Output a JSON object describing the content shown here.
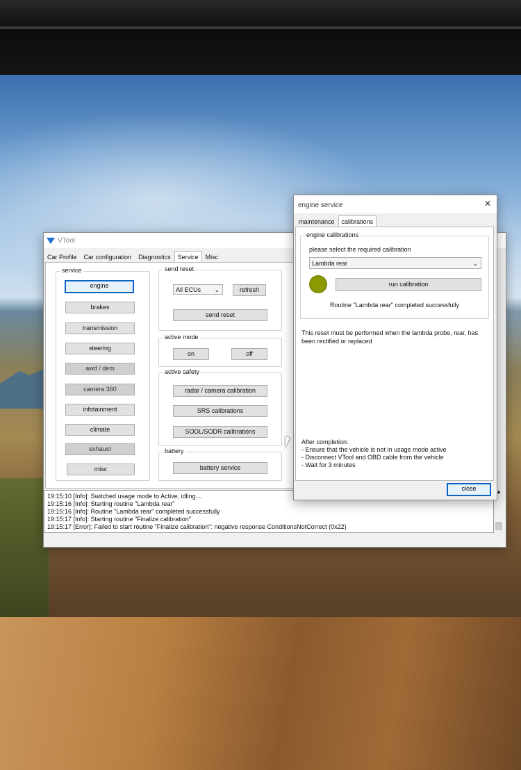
{
  "vtool": {
    "title": "VTool",
    "tabs": [
      "Car Profile",
      "Car configuration",
      "Diagnostics",
      "Service",
      "Misc"
    ],
    "active_tab": "Service",
    "service_group": {
      "label": "service",
      "buttons": [
        "engine",
        "brakes",
        "transmission",
        "steering",
        "awd / dem",
        "camera 360",
        "infotainment",
        "climate",
        "exhaust",
        "misc"
      ]
    },
    "send_reset": {
      "label": "send reset",
      "ecu_select": "All ECUs",
      "refresh": "refresh",
      "send": "send reset"
    },
    "active_mode": {
      "label": "active mode",
      "on": "on",
      "off": "off"
    },
    "active_safety": {
      "label": "active safety",
      "buttons": [
        "radar / camera calibration",
        "SRS calibrations",
        "SODL/SODR calibrations"
      ]
    },
    "battery": {
      "label": "battery",
      "button": "battery service"
    },
    "log": [
      "19:15:10 [Info]: Switched usage mode to Active, idling....",
      "19:15:16 [Info]: Starting routine \"Lambda rear\"",
      "19:15:16 [Info]: Routine \"Lambda rear\" completed successfully",
      "19:15:17 [Info]: Starting routine \"Finalize calibration\"",
      "19:15:17 [Error]: Failed to start routine \"Finalize calibration\": negative response ConditionsNotCorrect (0x22)"
    ]
  },
  "engine_service": {
    "title": "engine service",
    "close_glyph": "✕",
    "tabs": [
      "maintenance",
      "calibrations"
    ],
    "active_tab": "calibrations",
    "group_label": "engine calibrations",
    "prompt": "please select the required calibration",
    "selected": "Lambda rear",
    "run_button": "run calibration",
    "status_color": "#8a9a00",
    "result": "Routine \"Lambda rear\" completed successfully",
    "description": "This reset must be performed when the lambda probe, rear, has been rectified or replaced",
    "after_lines": [
      "After completion:",
      "- Ensure that the vehicle is not in usage mode active",
      "- Disconnect VTool and OBD cable from the vehicle",
      "- Wait for 3 minutes"
    ],
    "close_button": "close"
  },
  "icons": {
    "logo": "vtool-logo-icon",
    "dropdown": "chevron-down-icon",
    "cursor": "mouse-cursor-icon"
  }
}
